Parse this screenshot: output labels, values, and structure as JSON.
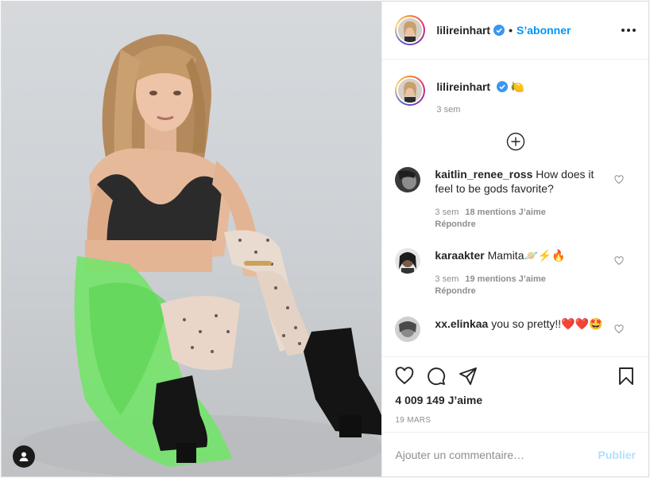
{
  "post": {
    "username": "lilireinhart",
    "follow_label": "S’abonner",
    "separator": "•",
    "caption_emoji": "🍋",
    "caption_time": "3 sem",
    "likes": "4 009 149 J’aime",
    "date": "19 MARS"
  },
  "comments": [
    {
      "user": "kaitlin_renee_ross",
      "text": "How does it feel to be gods favorite?",
      "time": "3 sem",
      "likes": "18 mentions J’aime",
      "reply": "Répondre"
    },
    {
      "user": "karaakter",
      "text": "Mamita🪐⚡🔥",
      "time": "3 sem",
      "likes": "19 mentions J’aime",
      "reply": "Répondre"
    },
    {
      "user": "xx.elinkaa",
      "text": "you so pretty!!❤️❤️🤩"
    }
  ],
  "add_comment": {
    "placeholder": "Ajouter un commentaire…",
    "publish_label": "Publier"
  },
  "icons": [
    "verified-badge-icon",
    "more-options-icon",
    "load-more-comments-icon",
    "heart-icon",
    "comment-icon",
    "share-icon",
    "save-icon",
    "user-tag-icon"
  ],
  "colors": {
    "link_blue": "#0095f6",
    "publish_disabled": "#b2dffc",
    "verified": "#3897f0"
  }
}
